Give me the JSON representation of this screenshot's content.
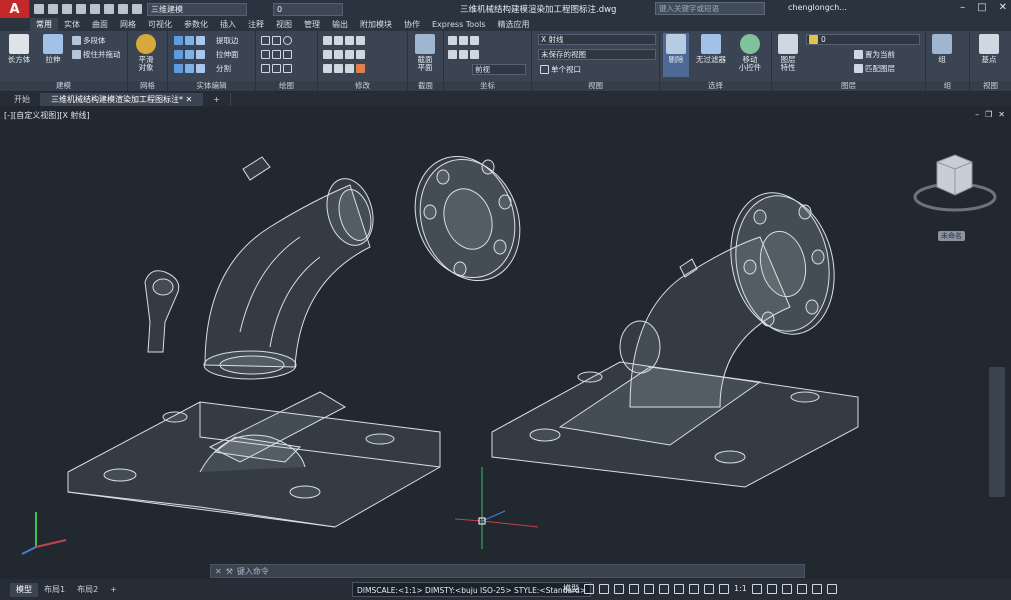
{
  "app": {
    "logo_letter": "A",
    "document_title": "三维机械结构建模渲染加工程图标注.dwg"
  },
  "qat": {
    "workspace": "三维建模",
    "layer_value": "0"
  },
  "search": {
    "placeholder": "键入关键字或短语"
  },
  "user": {
    "name": "chenglongch..."
  },
  "ribbon_tabs": [
    "常用",
    "实体",
    "曲面",
    "网格",
    "可视化",
    "参数化",
    "插入",
    "注释",
    "视图",
    "管理",
    "输出",
    "附加模块",
    "协作",
    "Express Tools",
    "精选应用"
  ],
  "ribbon": {
    "modeling": {
      "title": "建模",
      "box": "长方体",
      "extrude": "拉伸",
      "polysolid": "多段体",
      "presspull": "按住并拖动"
    },
    "mesh": {
      "title": "网格",
      "smooth": "平滑\n对象"
    },
    "solid_edit": {
      "title": "实体编辑",
      "extract_edges": "提取边",
      "extrude_faces": "拉伸面",
      "separate": "分割"
    },
    "draw": {
      "title": "绘图"
    },
    "modify": {
      "title": "修改"
    },
    "section": {
      "title": "截面",
      "plane": "截面\n平面"
    },
    "coordinates": {
      "title": "坐标",
      "view": "前视"
    },
    "view": {
      "title": "视图",
      "visual_style": "X 射线",
      "named_view": "未保存的视图",
      "viewport": "单个视口"
    },
    "selection": {
      "title": "选择",
      "culling": "剔除",
      "no_filter": "无过滤器",
      "move_gizmo": "移动\n小控件"
    },
    "layers": {
      "title": "图层",
      "props": "图层\n特性",
      "layer_value": "0",
      "set_current": "置为当前",
      "match": "匹配图层"
    },
    "groups": {
      "title": "组",
      "group": "组"
    },
    "viewpanel": {
      "title": "视图",
      "base": "基点"
    }
  },
  "file_tabs": [
    "开始",
    "三维机械结构建模渲染加工程图标注*"
  ],
  "viewport": {
    "label": "[-][自定义视图][X 射线]",
    "viewcube_label": "未命名"
  },
  "commandline": {
    "placeholder": "键入命令"
  },
  "layout_tabs": [
    "模型",
    "布局1",
    "布局2"
  ],
  "statusbar": {
    "dims": "DIMSCALE:<1:1> DIMSTY:<buju ISO-25> STYLE:<Standard>",
    "model_label": "模型",
    "scale": "1:1"
  },
  "colors": {
    "accent": "#c5282a",
    "ribbon_bg": "#3b4453",
    "viewport_bg": "#212830"
  }
}
